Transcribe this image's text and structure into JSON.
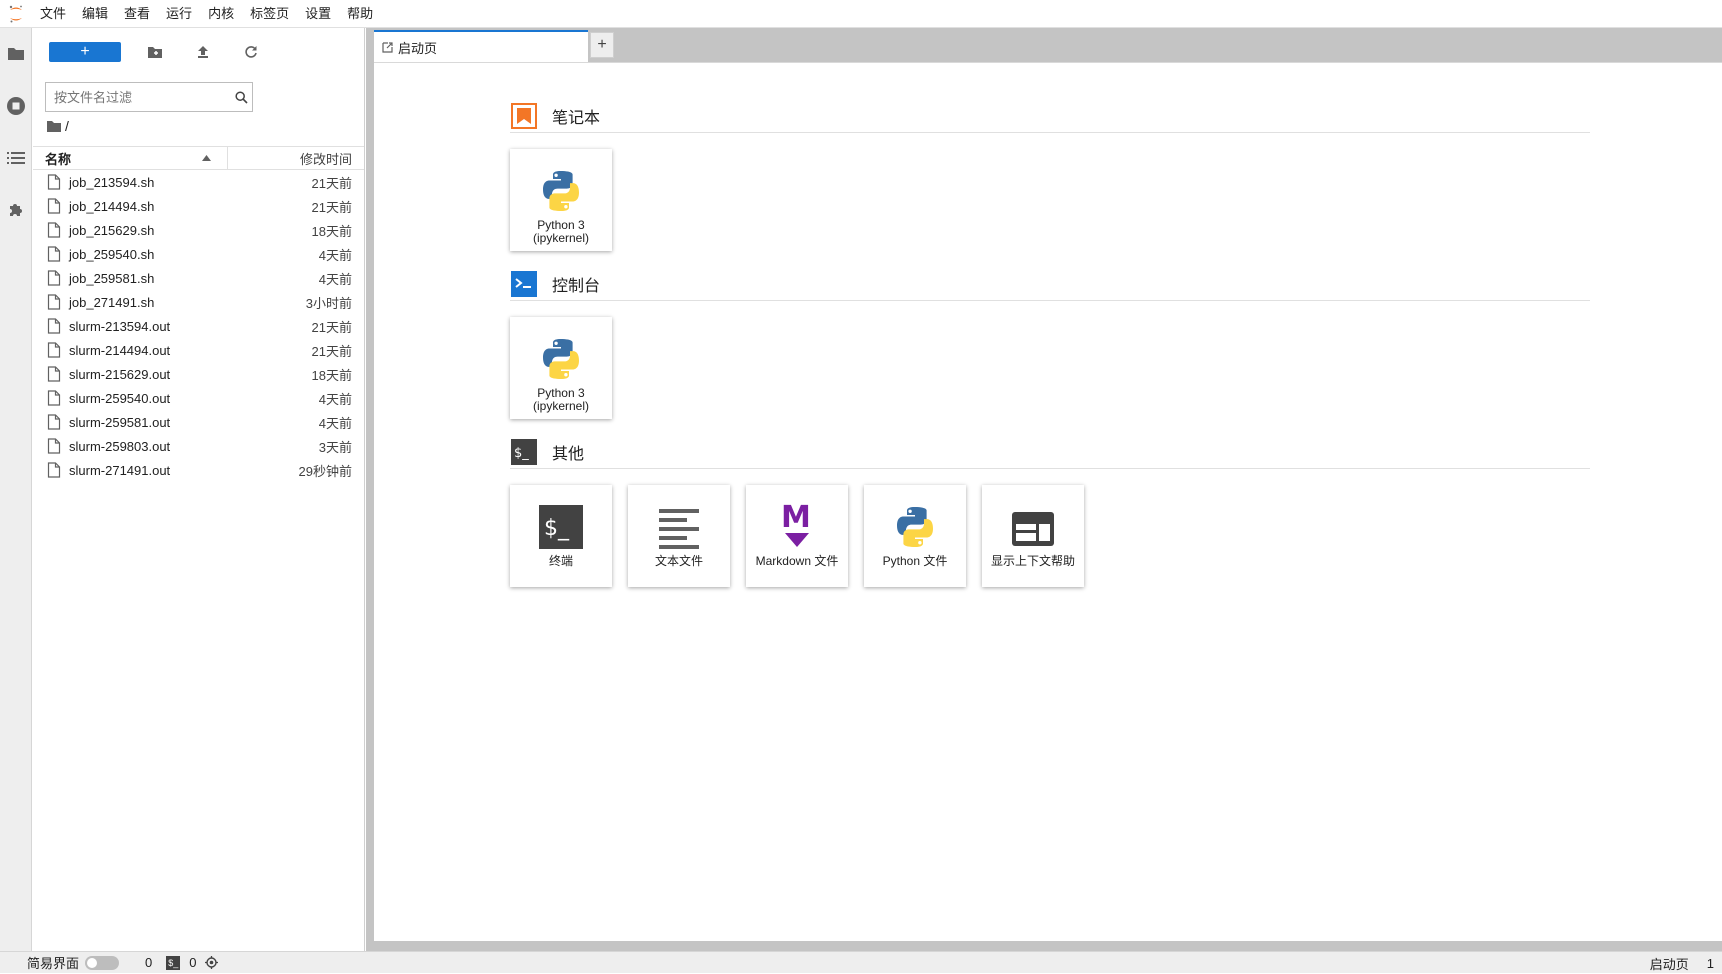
{
  "menu": [
    "文件",
    "编辑",
    "查看",
    "运行",
    "内核",
    "标签页",
    "设置",
    "帮助"
  ],
  "filebrowser": {
    "new_label": "+",
    "filter_placeholder": "按文件名过滤",
    "crumb": "/",
    "col_name": "名称",
    "col_modified": "修改时间",
    "files": [
      {
        "name": "job_213594.sh",
        "modified": "21天前"
      },
      {
        "name": "job_214494.sh",
        "modified": "21天前"
      },
      {
        "name": "job_215629.sh",
        "modified": "18天前"
      },
      {
        "name": "job_259540.sh",
        "modified": "4天前"
      },
      {
        "name": "job_259581.sh",
        "modified": "4天前"
      },
      {
        "name": "job_271491.sh",
        "modified": "3小时前"
      },
      {
        "name": "slurm-213594.out",
        "modified": "21天前"
      },
      {
        "name": "slurm-214494.out",
        "modified": "21天前"
      },
      {
        "name": "slurm-215629.out",
        "modified": "18天前"
      },
      {
        "name": "slurm-259540.out",
        "modified": "4天前"
      },
      {
        "name": "slurm-259581.out",
        "modified": "4天前"
      },
      {
        "name": "slurm-259803.out",
        "modified": "3天前"
      },
      {
        "name": "slurm-271491.out",
        "modified": "29秒钟前"
      }
    ]
  },
  "tabs": {
    "launcher_label": "启动页",
    "add_label": "+"
  },
  "launcher": {
    "notebook": {
      "title": "笔记本",
      "cards": [
        {
          "line1": "Python 3",
          "line2": "(ipykernel)"
        }
      ]
    },
    "console": {
      "title": "控制台",
      "cards": [
        {
          "line1": "Python 3",
          "line2": "(ipykernel)"
        }
      ]
    },
    "other": {
      "title": "其他",
      "cards": [
        {
          "label": "终端",
          "icon": "terminal-icon"
        },
        {
          "label": "文本文件",
          "icon": "text-file-icon"
        },
        {
          "label": "Markdown 文件",
          "icon": "markdown-icon"
        },
        {
          "label": "Python 文件",
          "icon": "python-icon"
        },
        {
          "label": "显示上下文帮助",
          "icon": "context-help-icon"
        }
      ]
    }
  },
  "status": {
    "simple_label": "简易界面",
    "kernels_count": "0",
    "terminals_count": "0",
    "right_label": "启动页",
    "right_count": "1"
  },
  "colors": {
    "accent": "#1976d2",
    "notebook_icon": "#f37626",
    "console_icon": "#1976d2",
    "markdown": "#7b1fa2"
  }
}
